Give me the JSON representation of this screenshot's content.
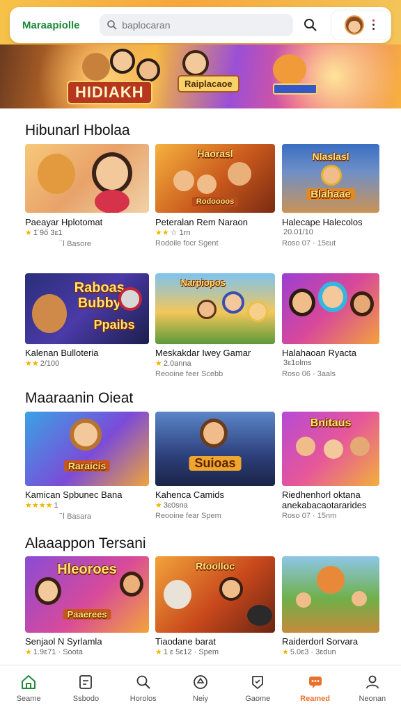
{
  "header": {
    "logo": "Maraapiolle",
    "search_placeholder": "baplocaran",
    "accent": "#1d8b3a"
  },
  "banner": {
    "title": "HIDIAKH",
    "sign": "Raiplacaoe"
  },
  "sections": [
    {
      "title": "Hibunarl Hbolaa",
      "cards": [
        {
          "thumb_label": "",
          "title": "Paeayar Hplotomat",
          "stars": "★",
          "rating": "1̈ 9ő 3ɛ1",
          "meta": "ﺍ̈ Basorе"
        },
        {
          "thumb_label": "Haorasl",
          "thumb_label2": "Rodoooos",
          "title": "Peteralan Rem Naraon",
          "stars": "★★",
          "rating": "☆ 1rn",
          "meta": "Rodoile focr Sgent"
        },
        {
          "thumb_label": "Nlaslasl",
          "thumb_label2": "Blahaae",
          "title": "Halecape Halecolos",
          "stars": "",
          "rating": "20.01/10",
          "meta": "Roso 07 · 15ɛut"
        }
      ]
    },
    {
      "title": "",
      "cards": [
        {
          "thumb_label": "Raboas",
          "thumb_label2": "Bubby",
          "thumb_label3": "Ppaibs",
          "title": "Kalenan Bulloteria",
          "stars": "★★",
          "rating": "2/100",
          "meta": ""
        },
        {
          "thumb_label": "Narpiopos",
          "title": "Meskakdar Iwey Gamar",
          "stars": "★",
          "rating": "2.0anna",
          "meta": "Reooine feer Scebb"
        },
        {
          "thumb_label": "",
          "title": "Halahaoan Ryacta",
          "stars": "",
          "rating": "3ɛ1olms",
          "meta": "Roso 06 · 3aals"
        }
      ]
    },
    {
      "title": "Maaraanin Oieat",
      "cards": [
        {
          "thumb_label": "Raraicis",
          "title": "Kamican Spbunec Bana",
          "stars": "★★★★",
          "rating": "1",
          "meta": "ﺍ̈ Basara"
        },
        {
          "thumb_label": "Suioas",
          "title": "Kahenca Camids",
          "stars": "★",
          "rating": "3ɛ0sna",
          "meta": "Reooine fear Spem"
        },
        {
          "thumb_label": "Bnitaus",
          "title": "Riedhenhorl oktana",
          "title2": "anekabacaotararides",
          "stars": "",
          "rating": "",
          "meta": "Roso 07 · 15nm"
        }
      ]
    },
    {
      "title": "Alaaappon Tersani",
      "cards": [
        {
          "thumb_label": "Hleoroes",
          "thumb_label2": "Paaerees",
          "title": "Senjaol N Syrlamla",
          "stars": "★",
          "rating": "1.9ɛ71 · Soota",
          "meta": ""
        },
        {
          "thumb_label": "Rtoolloc",
          "title": "Tiaodane barat",
          "stars": "★",
          "rating": "1 ɛ 5ɛ12 · Spem",
          "meta": ""
        },
        {
          "thumb_label": "",
          "title": "Raiderdorl Sorvara",
          "stars": "★",
          "rating": "5.0ɛ3 · 3ɛdun",
          "meta": ""
        }
      ]
    }
  ],
  "nav": [
    {
      "label": "Seame",
      "icon": "home-icon",
      "active": false
    },
    {
      "label": "Ssbodo",
      "icon": "square-icon",
      "active": false
    },
    {
      "label": "Horolos",
      "icon": "search-icon",
      "active": false
    },
    {
      "label": "Neiy",
      "icon": "circle-icon",
      "active": false
    },
    {
      "label": "Gaome",
      "icon": "badge-icon",
      "active": false
    },
    {
      "label": "Reamed",
      "icon": "chat-icon",
      "active": true
    },
    {
      "label": "Neonan",
      "icon": "user-icon",
      "active": false
    }
  ],
  "colors": {
    "active_nav": "#e8722c",
    "star": "#f0b400"
  }
}
